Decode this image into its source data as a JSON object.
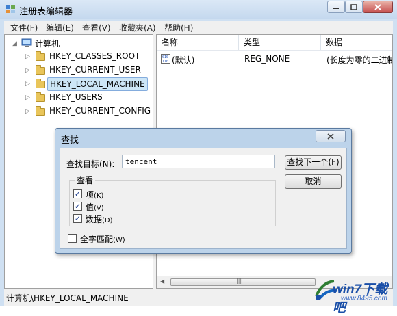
{
  "window": {
    "title": "注册表编辑器"
  },
  "menu": [
    "文件(F)",
    "编辑(E)",
    "查看(V)",
    "收藏夹(A)",
    "帮助(H)"
  ],
  "tree": {
    "root": "计算机",
    "items": [
      "HKEY_CLASSES_ROOT",
      "HKEY_CURRENT_USER",
      "HKEY_LOCAL_MACHINE",
      "HKEY_USERS",
      "HKEY_CURRENT_CONFIG"
    ],
    "selected": "HKEY_LOCAL_MACHINE"
  },
  "list": {
    "columns": [
      "名称",
      "类型",
      "数据"
    ],
    "rows": [
      {
        "name": "(默认)",
        "type": "REG_NONE",
        "data": "(长度为零的二进制"
      }
    ]
  },
  "status": {
    "path": "计算机\\HKEY_LOCAL_MACHINE"
  },
  "find_dialog": {
    "title": "查找",
    "find_label": "查找目标(N):",
    "find_value": "tencent",
    "find_next": "查找下一个(F)",
    "cancel": "取消",
    "lookat_title": "查看",
    "options": [
      {
        "label": "项",
        "key": "(K)",
        "checked": true
      },
      {
        "label": "值",
        "key": "(V)",
        "checked": true
      },
      {
        "label": "数据",
        "key": "(D)",
        "checked": true
      }
    ],
    "match_whole": {
      "label": "全字匹配",
      "key": "(W)",
      "checked": false
    }
  },
  "watermark": {
    "brand": "win7下载吧",
    "url": "www.8495.com"
  },
  "colors": {
    "selection": "#cde6f7",
    "dialog_frame": "#bcd3ea",
    "watermark": "#1a4fa8"
  }
}
